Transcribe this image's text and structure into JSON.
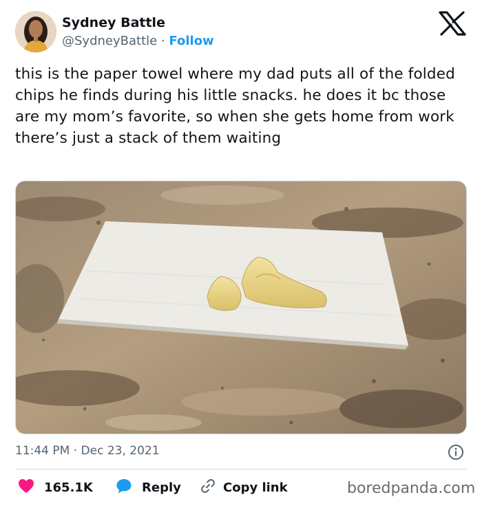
{
  "author": {
    "name": "Sydney Battle",
    "handle": "@SydneyBattle",
    "separator": "·",
    "follow_label": "Follow"
  },
  "tweet": {
    "text": "this is the paper towel where my dad puts all of the folded chips he finds during his little snacks. he does it bc those are my mom’s favorite, so when she gets home from work there’s just a stack of them waiting",
    "time": "11:44 PM",
    "meta_separator": "·",
    "date": "Dec 23, 2021"
  },
  "actions": {
    "like_count": "165.1K",
    "reply_label": "Reply",
    "copy_link_label": "Copy link"
  },
  "watermark": "boredpanda.com",
  "icons": {
    "logo": "x-logo-icon",
    "info": "info-icon",
    "like": "heart-icon",
    "reply": "speech-bubble-icon",
    "copy": "link-icon"
  },
  "colors": {
    "accent": "#1d9bf0",
    "like": "#f91880",
    "text": "#0f1419",
    "muted": "#536471"
  }
}
